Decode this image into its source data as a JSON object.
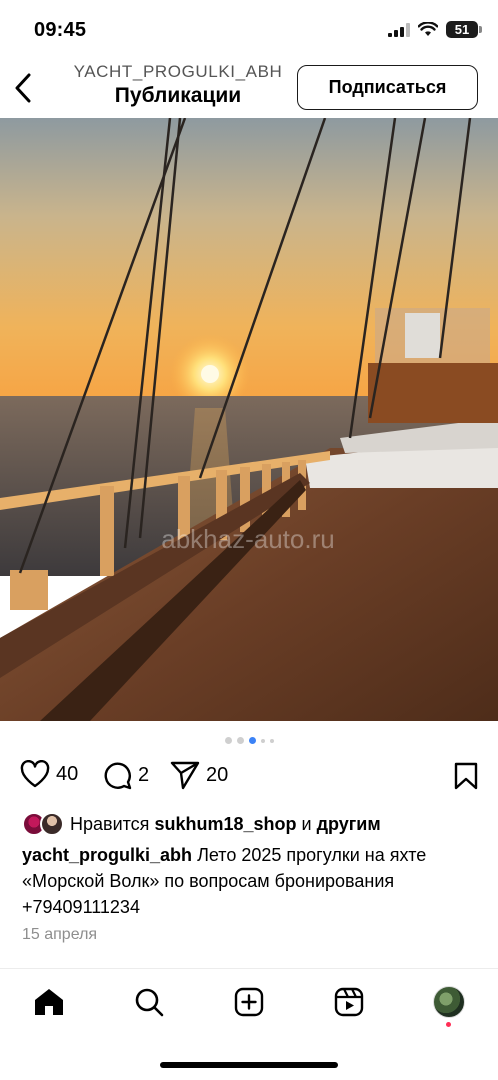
{
  "status_bar": {
    "time": "09:45",
    "battery": "51"
  },
  "header": {
    "username": "YACHT_PROGULKI_ABH",
    "title": "Публикации",
    "follow_label": "Подписаться"
  },
  "post": {
    "watermark": "abkhaz-auto.ru",
    "carousel": {
      "count": 5,
      "active": 3
    },
    "likes_count": "40",
    "comments_count": "2",
    "shares_count": "20",
    "liked_by_prefix": "Нравится",
    "liked_by_user": "sukhum18_shop",
    "liked_by_and": "и",
    "liked_by_others": "другим",
    "caption_user": "yacht_progulki_abh",
    "caption_text": "Лето 2025 прогулки на яхте «Морской Волк» по вопросам бронирования +79409111234",
    "date": "15 апреля"
  },
  "tabbar": {
    "items": [
      "home-icon",
      "search-icon",
      "create-icon",
      "reels-icon",
      "profile-avatar"
    ]
  },
  "colors": {
    "accent_dot": "#3b82f6",
    "notification": "#ff2d55"
  }
}
